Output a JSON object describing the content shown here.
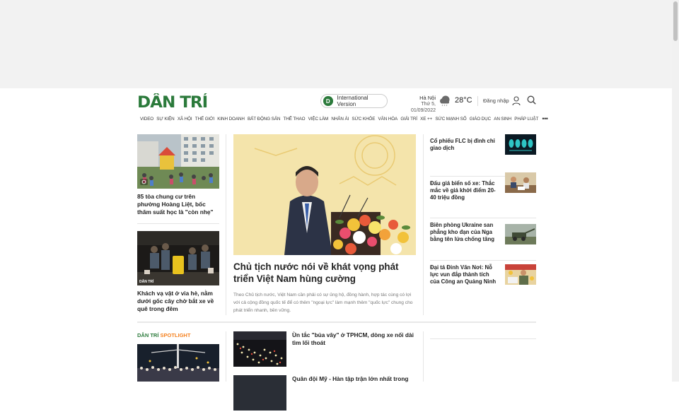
{
  "header": {
    "logo_text": "DÂN TRÍ",
    "intl_label": "International Version",
    "intl_icon_letter": "D",
    "city": "Hà Nội",
    "date": "Thứ 5, 01/09/2022",
    "temperature": "28°C",
    "login_label": "Đăng nhập"
  },
  "nav": {
    "items": [
      "VIDEO",
      "SỰ KIỆN",
      "XÃ HỘI",
      "THẾ GIỚI",
      "KINH DOANH",
      "BẤT ĐỘNG SẢN",
      "THỂ THAO",
      "VIỆC LÀM",
      "NHÂN ÁI",
      "SỨC KHỎE",
      "VĂN HÓA",
      "GIẢI TRÍ",
      "XE ++",
      "SỨC MẠNH SỐ",
      "GIÁO DỤC",
      "AN SINH",
      "PHÁP LUẬT"
    ],
    "more": "•••"
  },
  "left_stories": [
    {
      "title": "85 tòa chung cư trên phường Hoàng Liệt, bốc thăm suất học là \"còn nhẹ\""
    },
    {
      "title": "Khách vạ vật ở vỉa hè, nằm dưới gốc cây chờ bắt xe về quê trong đêm"
    }
  ],
  "main_story": {
    "title": "Chủ tịch nước nói về khát vọng phát triển Việt Nam hùng cường",
    "sapo": "Theo Chủ tịch nước, Việt Nam cần phải có sự ủng hộ, đồng hành, hợp tác cùng có lợi với cả cộng đồng quốc tế để có thêm \"ngoại lực\" làm mạnh thêm \"quốc lực\" chung cho phát triển nhanh, bền vững."
  },
  "right_stories": [
    {
      "title": "Cổ phiếu FLC bị đình chỉ giao dịch"
    },
    {
      "title": "Đấu giá biển số xe: Thắc mắc về giá khởi điểm 20-40 triệu đồng"
    },
    {
      "title": "Biên phòng Ukraine san phẳng kho đạn của Nga bằng tên lửa chống tăng"
    },
    {
      "title": "Đại tá Đinh Văn Nơi: Nỗ lực vun đắp thành tích của Công an Quảng Ninh"
    }
  ],
  "spotlight": {
    "part1": "DÂN TRÍ",
    "part2": "SPOTLIGHT"
  },
  "second_list": [
    {
      "title": "Ùn tắc \"bủa vây\" ở TPHCM, dòng xe nối dài tìm lối thoát"
    },
    {
      "title": "Quân đội Mỹ - Hàn tập trận lớn nhất trong"
    }
  ],
  "colors": {
    "brand_green": "#2b7a3b",
    "spotlight_orange": "#f58220"
  }
}
